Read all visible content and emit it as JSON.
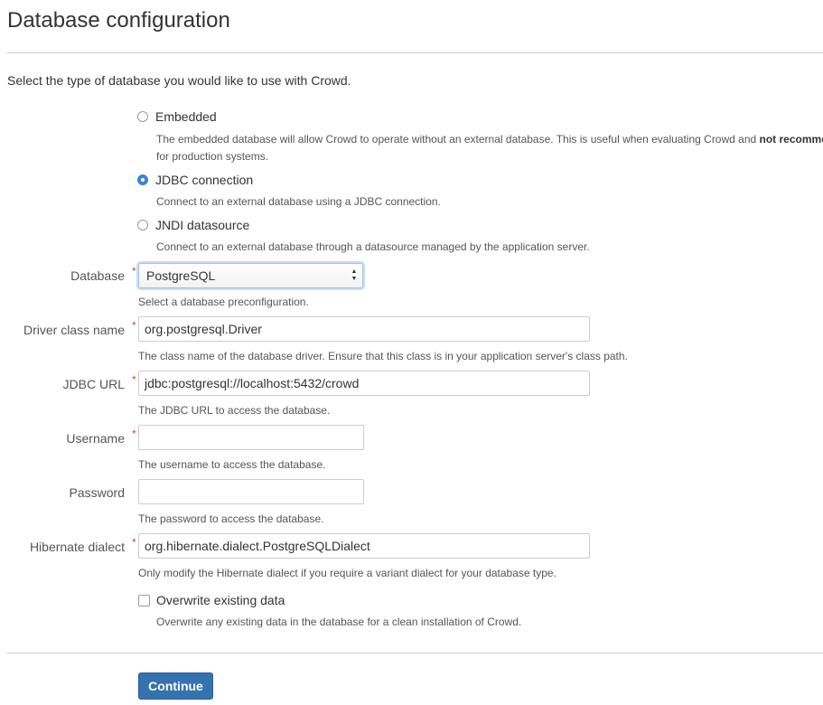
{
  "page": {
    "title": "Database configuration",
    "intro": "Select the type of database you would like to use with Crowd."
  },
  "db_type": {
    "options": [
      {
        "label": "Embedded",
        "checked": false,
        "desc_line1_prefix": "The embedded database will allow Crowd to operate without an external database. This is useful when evaluating Crowd and ",
        "desc_line1_bold": "not recomme",
        "desc_line2": "for production systems."
      },
      {
        "label": "JDBC connection",
        "checked": true,
        "desc": "Connect to an external database using a JDBC connection."
      },
      {
        "label": "JNDI datasource",
        "checked": false,
        "desc": "Connect to an external database through a datasource managed by the application server."
      }
    ]
  },
  "fields": {
    "database": {
      "label": "Database",
      "required": "*",
      "value": "PostgreSQL",
      "help": "Select a database preconfiguration."
    },
    "driver": {
      "label": "Driver class name",
      "required": "*",
      "value": "org.postgresql.Driver",
      "help": "The class name of the database driver. Ensure that this class is in your application server's class path."
    },
    "jdbc_url": {
      "label": "JDBC URL",
      "required": "*",
      "value": "jdbc:postgresql://localhost:5432/crowd",
      "help": "The JDBC URL to access the database."
    },
    "username": {
      "label": "Username",
      "required": "*",
      "value": "",
      "help": "The username to access the database."
    },
    "password": {
      "label": "Password",
      "value": "",
      "help": "The password to access the database."
    },
    "dialect": {
      "label": "Hibernate dialect",
      "required": "*",
      "value": "org.hibernate.dialect.PostgreSQLDialect",
      "help": "Only modify the Hibernate dialect if you require a variant dialect for your database type."
    }
  },
  "overwrite": {
    "label": "Overwrite existing data",
    "checked": false,
    "desc": "Overwrite any existing data in the database for a clean installation of Crowd."
  },
  "actions": {
    "continue_label": "Continue"
  },
  "colors": {
    "primary_button": "#3572b0",
    "required_marker": "#d04437",
    "radio_selected": "#3b82d9"
  }
}
